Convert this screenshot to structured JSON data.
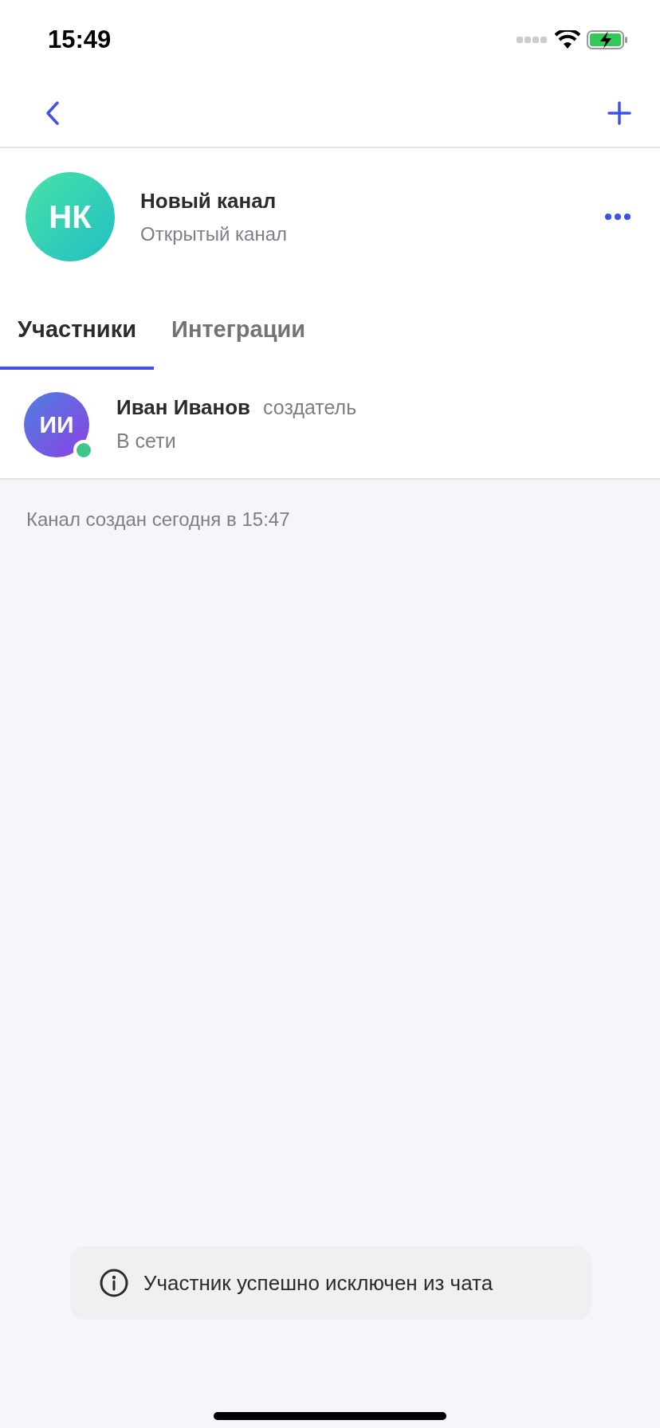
{
  "status_bar": {
    "time": "15:49",
    "charging": true
  },
  "channel": {
    "initials": "НК",
    "name": "Новый канал",
    "subtitle": "Открытый канал"
  },
  "tabs": [
    {
      "label": "Участники",
      "selected": true
    },
    {
      "label": "Интеграции",
      "selected": false
    }
  ],
  "members": [
    {
      "initials": "ИИ",
      "name": "Иван Иванов",
      "role": "создатель",
      "status": "В сети",
      "online": true
    }
  ],
  "created_note": "Канал создан сегодня в 15:47",
  "toast": {
    "message": "Участник успешно исключен из чата"
  }
}
